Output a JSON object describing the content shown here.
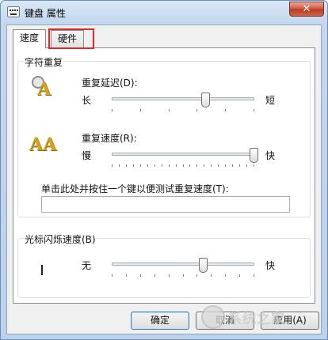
{
  "window": {
    "title": "键盘 属性",
    "close_symbol": "✕"
  },
  "tabs": [
    {
      "label": "速度",
      "selected": true
    },
    {
      "label": "硬件",
      "selected": false,
      "highlighted": true
    }
  ],
  "char_repeat": {
    "group_title": "字符重复",
    "delay": {
      "label": "重复延迟(D):",
      "left": "长",
      "right": "短",
      "value_fraction": 0.66
    },
    "rate": {
      "label": "重复速度(R):",
      "left": "慢",
      "right": "快",
      "value_fraction": 1.0
    },
    "test_label": "单击此处并按住一个键以便测试重复速度(T):",
    "test_value": ""
  },
  "cursor_blink": {
    "group_title": "光标闪烁速度(B)",
    "left": "无",
    "right": "快",
    "value_fraction": 0.64
  },
  "buttons": {
    "ok": "确定",
    "cancel": "取消",
    "apply": "应用(A)"
  },
  "watermark": {
    "text": "系统之家"
  },
  "colors": {
    "highlight": "#e02b2b",
    "accent": "#3c7fb1"
  },
  "icons": {
    "window": "keyboard-icon",
    "delay": "stopwatch-letter-a-icon",
    "rate": "double-letter-a-icon",
    "close": "close-icon"
  }
}
